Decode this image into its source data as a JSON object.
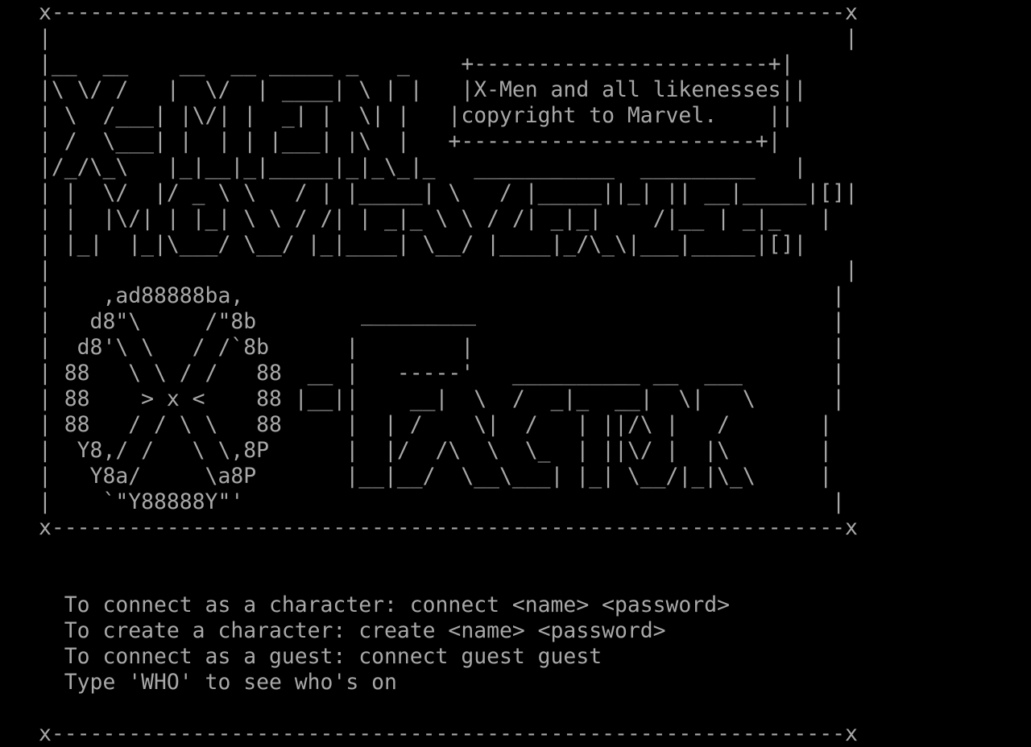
{
  "screen": {
    "banner": {
      "top_border": "x--------------------------------------------------------------x",
      "copyright_box": {
        "top": "+-----------------------+",
        "line1": "|X-Men and all likenesses|",
        "line2": "|copyright to Marvel.    |",
        "bottom": "+-----------------------+"
      },
      "title_art": [
        "|                                                              |",
        "|__  __    __  __ _____ _   _    +-----------------------+|",
        "|\\ \\/ /   |  \\/  | ____| \\ | |   |X-Men and all likenesses||",
        "| \\  /___| |\\/| |  _| |  \\| |   |copyright to Marvel.    ||",
        "| /  \\___| |  | | |___| |\\  |   +-----------------------+|",
        "|/_/\\_\\   |_|__|_|_____|_|_\\_|_   ___________  _________   |",
        "| |  \\/  |/ _ \\ \\   / | |_____| \\   / |_____||_| || __|_____|[]|",
        "| |  |\\/| | |_| \\ \\ / /| | _|_ \\ \\ / /| _|_|    /|__ | _|_   |",
        "| |_|  |_|\\___/ \\__/ |_|____| \\__/ |____|_/\\_\\|___|_____|[]|",
        "|                                                              |"
      ],
      "logo_art": [
        "|    ,ad88888ba,                                              |",
        "|   d8\"\\     /\"8b                                             |",
        "|  d8'\\ \\   / /`8b      |        |                            |",
        "| 88   \\ \\ / /   88  __ |   -----'   __________ __  ___       |",
        "| 88    > x <    88 |__||    __|  \\  /  _|_  __|  \\|   \\      |",
        "| 88   / / \\ \\   88     |  | /    \\|  /   | ||/\\ |   /       |",
        "|  Y8,/ /   \\ \\,8P      |  |/  /\\  \\  \\_  | ||\\/ |  |\\       |",
        "|   Y8a/     \\a8P       |__|__/  \\__\\___| |_| \\__/|_|\\_\\     |",
        "|    `\"Y88888Y\"'                                              |"
      ],
      "logo_top_bar": "_________",
      "bottom_border": "x--------------------------------------------------------------x"
    },
    "instructions": {
      "line1": "  To connect as a character: connect <name> <password>",
      "line2": "  To create a character: create <name> <password>",
      "line3": "  To connect as a guest: connect guest guest",
      "line4": "  Type 'WHO' to see who's on"
    },
    "footer_border": "x--------------------------------------------------------------x"
  },
  "colors": {
    "background": "#000000",
    "foreground": "#a8a8a8"
  }
}
